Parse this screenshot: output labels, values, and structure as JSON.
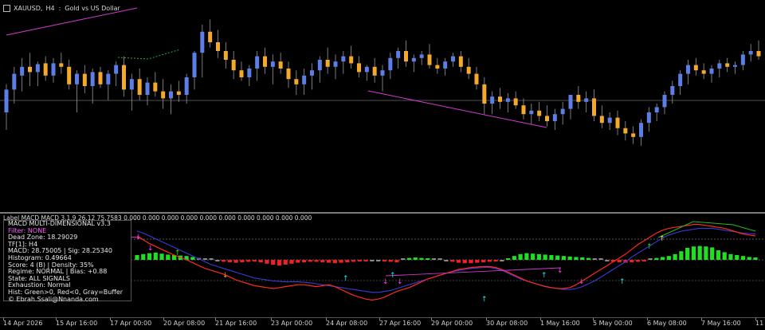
{
  "symbol": {
    "ticker": "XAUUSD",
    "timeframe": "H4",
    "description": "Gold vs US Dollar"
  },
  "indicator_label": "Label MACD  MACD 3.1.9 26.12 75.7583 0.000 0.000 0.000 0.000 0.000 0.000 0.000 0.000 0.000 0.000",
  "panel": {
    "lines": [
      "MACD MULTI-DIMENSIONAL v3.3",
      "Filter: NONE",
      "Dead Zone: 18.29029",
      "TF[1]: H4",
      "MACD: 28.75005 | Sig: 28.25340",
      "Histogram: 0.49664",
      "Score: 4 (B) | Density: 35%",
      "Regime: NORMAL | Bias: +0.88",
      "State: ALL SIGNALS",
      "Exhaustion: Normal",
      "Hist: Green>0, Red<0, Gray=Buffer",
      "© Ebrah.Ssali@Nnanda.com"
    ]
  },
  "time_axis": [
    "14 Apr 2026",
    "15 Apr 16:00",
    "17 Apr 00:00",
    "20 Apr 08:00",
    "21 Apr 16:00",
    "23 Apr 00:00",
    "24 Apr 08:00",
    "27 Apr 16:00",
    "29 Apr 00:00",
    "30 Apr 08:00",
    "1 May 16:00",
    "5 May 00:00",
    "6 May 08:00",
    "7 May 16:00",
    "11"
  ],
  "colors": {
    "bull": "#5b7fe6",
    "bear": "#f4a92a",
    "background": "#000000",
    "hist_green": "#22dd22",
    "hist_red": "#ee2222",
    "hist_gray": "#8a8a8a",
    "macd_line": "#ff2a1a",
    "signal_line": "#3a3ad8",
    "pink": "#ff3cff",
    "cyan": "#22e6e6"
  },
  "candles": [
    {
      "o": 2.1,
      "h": 1.78,
      "l": 2.3,
      "c": 1.84
    },
    {
      "o": 1.84,
      "h": 1.58,
      "l": 2.0,
      "c": 1.66
    },
    {
      "o": 1.68,
      "h": 1.48,
      "l": 1.86,
      "c": 1.58
    },
    {
      "o": 1.58,
      "h": 1.42,
      "l": 1.8,
      "c": 1.64
    },
    {
      "o": 1.64,
      "h": 1.52,
      "l": 1.8,
      "c": 1.55
    },
    {
      "o": 1.54,
      "h": 1.46,
      "l": 1.74,
      "c": 1.68
    },
    {
      "o": 1.68,
      "h": 1.48,
      "l": 1.76,
      "c": 1.54
    },
    {
      "o": 1.54,
      "h": 1.42,
      "l": 1.66,
      "c": 1.58
    },
    {
      "o": 1.58,
      "h": 1.5,
      "l": 1.84,
      "c": 1.78
    },
    {
      "o": 1.78,
      "h": 1.62,
      "l": 2.1,
      "c": 1.66
    },
    {
      "o": 1.66,
      "h": 1.56,
      "l": 1.88,
      "c": 1.8
    },
    {
      "o": 1.8,
      "h": 1.6,
      "l": 2.0,
      "c": 1.64
    },
    {
      "o": 1.64,
      "h": 1.58,
      "l": 1.82,
      "c": 1.78
    },
    {
      "o": 1.78,
      "h": 1.62,
      "l": 1.96,
      "c": 1.66
    },
    {
      "o": 1.66,
      "h": 1.52,
      "l": 1.8,
      "c": 1.56
    },
    {
      "o": 1.56,
      "h": 1.46,
      "l": 1.92,
      "c": 1.84
    },
    {
      "o": 1.84,
      "h": 1.66,
      "l": 2.08,
      "c": 1.72
    },
    {
      "o": 1.72,
      "h": 1.6,
      "l": 1.96,
      "c": 1.9
    },
    {
      "o": 1.9,
      "h": 1.7,
      "l": 2.02,
      "c": 1.76
    },
    {
      "o": 1.76,
      "h": 1.64,
      "l": 1.92,
      "c": 1.86
    },
    {
      "o": 1.86,
      "h": 1.72,
      "l": 2.06,
      "c": 1.94
    },
    {
      "o": 1.94,
      "h": 1.78,
      "l": 2.12,
      "c": 1.86
    },
    {
      "o": 1.86,
      "h": 1.74,
      "l": 1.98,
      "c": 1.9
    },
    {
      "o": 1.9,
      "h": 1.66,
      "l": 2.0,
      "c": 1.7
    },
    {
      "o": 1.7,
      "h": 1.4,
      "l": 1.84,
      "c": 1.42
    },
    {
      "o": 1.42,
      "h": 1.1,
      "l": 1.7,
      "c": 1.18
    },
    {
      "o": 1.18,
      "h": 1.04,
      "l": 1.36,
      "c": 1.3
    },
    {
      "o": 1.3,
      "h": 1.16,
      "l": 1.48,
      "c": 1.4
    },
    {
      "o": 1.4,
      "h": 1.3,
      "l": 1.6,
      "c": 1.5
    },
    {
      "o": 1.5,
      "h": 1.4,
      "l": 1.72,
      "c": 1.62
    },
    {
      "o": 1.62,
      "h": 1.52,
      "l": 1.74,
      "c": 1.7
    },
    {
      "o": 1.7,
      "h": 1.56,
      "l": 1.8,
      "c": 1.6
    },
    {
      "o": 1.6,
      "h": 1.4,
      "l": 1.74,
      "c": 1.46
    },
    {
      "o": 1.46,
      "h": 1.36,
      "l": 1.66,
      "c": 1.58
    },
    {
      "o": 1.58,
      "h": 1.44,
      "l": 1.78,
      "c": 1.52
    },
    {
      "o": 1.52,
      "h": 1.42,
      "l": 1.66,
      "c": 1.6
    },
    {
      "o": 1.6,
      "h": 1.52,
      "l": 1.82,
      "c": 1.72
    },
    {
      "o": 1.72,
      "h": 1.62,
      "l": 1.9,
      "c": 1.78
    },
    {
      "o": 1.78,
      "h": 1.6,
      "l": 1.9,
      "c": 1.68
    },
    {
      "o": 1.68,
      "h": 1.54,
      "l": 1.84,
      "c": 1.62
    },
    {
      "o": 1.62,
      "h": 1.46,
      "l": 1.76,
      "c": 1.5
    },
    {
      "o": 1.5,
      "h": 1.36,
      "l": 1.66,
      "c": 1.58
    },
    {
      "o": 1.58,
      "h": 1.44,
      "l": 1.72,
      "c": 1.52
    },
    {
      "o": 1.52,
      "h": 1.4,
      "l": 1.66,
      "c": 1.46
    },
    {
      "o": 1.46,
      "h": 1.34,
      "l": 1.6,
      "c": 1.54
    },
    {
      "o": 1.54,
      "h": 1.46,
      "l": 1.7,
      "c": 1.64
    },
    {
      "o": 1.64,
      "h": 1.56,
      "l": 1.74,
      "c": 1.58
    },
    {
      "o": 1.58,
      "h": 1.48,
      "l": 1.76,
      "c": 1.68
    },
    {
      "o": 1.68,
      "h": 1.56,
      "l": 1.86,
      "c": 1.62
    },
    {
      "o": 1.62,
      "h": 1.42,
      "l": 1.72,
      "c": 1.48
    },
    {
      "o": 1.48,
      "h": 1.36,
      "l": 1.6,
      "c": 1.4
    },
    {
      "o": 1.4,
      "h": 1.28,
      "l": 1.58,
      "c": 1.52
    },
    {
      "o": 1.52,
      "h": 1.44,
      "l": 1.64,
      "c": 1.48
    },
    {
      "o": 1.48,
      "h": 1.4,
      "l": 1.56,
      "c": 1.44
    },
    {
      "o": 1.44,
      "h": 1.32,
      "l": 1.6,
      "c": 1.56
    },
    {
      "o": 1.56,
      "h": 1.48,
      "l": 1.66,
      "c": 1.6
    },
    {
      "o": 1.6,
      "h": 1.48,
      "l": 1.68,
      "c": 1.52
    },
    {
      "o": 1.52,
      "h": 1.42,
      "l": 1.58,
      "c": 1.46
    },
    {
      "o": 1.46,
      "h": 1.4,
      "l": 1.64,
      "c": 1.58
    },
    {
      "o": 1.58,
      "h": 1.48,
      "l": 1.72,
      "c": 1.66
    },
    {
      "o": 1.66,
      "h": 1.58,
      "l": 1.84,
      "c": 1.78
    },
    {
      "o": 1.78,
      "h": 1.7,
      "l": 2.12,
      "c": 2.0
    },
    {
      "o": 2.0,
      "h": 1.86,
      "l": 2.12,
      "c": 1.92
    },
    {
      "o": 1.92,
      "h": 1.82,
      "l": 2.06,
      "c": 1.98
    },
    {
      "o": 1.98,
      "h": 1.88,
      "l": 2.1,
      "c": 1.94
    },
    {
      "o": 1.94,
      "h": 1.86,
      "l": 2.06,
      "c": 2.02
    },
    {
      "o": 2.02,
      "h": 1.94,
      "l": 2.18,
      "c": 2.12
    },
    {
      "o": 2.12,
      "h": 2.0,
      "l": 2.24,
      "c": 2.08
    },
    {
      "o": 2.08,
      "h": 1.98,
      "l": 2.2,
      "c": 2.14
    },
    {
      "o": 2.14,
      "h": 2.02,
      "l": 2.26,
      "c": 2.2
    },
    {
      "o": 2.2,
      "h": 2.06,
      "l": 2.3,
      "c": 2.12
    },
    {
      "o": 2.12,
      "h": 1.98,
      "l": 2.24,
      "c": 2.06
    },
    {
      "o": 2.06,
      "h": 1.94,
      "l": 2.18,
      "c": 1.9
    },
    {
      "o": 1.9,
      "h": 1.8,
      "l": 2.06,
      "c": 1.98
    },
    {
      "o": 1.98,
      "h": 1.86,
      "l": 2.1,
      "c": 1.94
    },
    {
      "o": 1.94,
      "h": 1.84,
      "l": 2.2,
      "c": 2.14
    },
    {
      "o": 2.14,
      "h": 2.02,
      "l": 2.28,
      "c": 2.22
    },
    {
      "o": 2.22,
      "h": 2.1,
      "l": 2.3,
      "c": 2.16
    },
    {
      "o": 2.16,
      "h": 2.08,
      "l": 2.36,
      "c": 2.28
    },
    {
      "o": 2.28,
      "h": 2.2,
      "l": 2.42,
      "c": 2.34
    },
    {
      "o": 2.34,
      "h": 2.26,
      "l": 2.46,
      "c": 2.38
    },
    {
      "o": 2.38,
      "h": 2.18,
      "l": 2.48,
      "c": 2.22
    },
    {
      "o": 2.22,
      "h": 2.04,
      "l": 2.32,
      "c": 2.1
    },
    {
      "o": 2.1,
      "h": 2.0,
      "l": 2.2,
      "c": 2.04
    },
    {
      "o": 2.04,
      "h": 1.86,
      "l": 2.12,
      "c": 1.9
    },
    {
      "o": 1.9,
      "h": 1.74,
      "l": 2.0,
      "c": 1.8
    },
    {
      "o": 1.8,
      "h": 1.62,
      "l": 1.9,
      "c": 1.66
    },
    {
      "o": 1.66,
      "h": 1.5,
      "l": 1.78,
      "c": 1.56
    },
    {
      "o": 1.56,
      "h": 1.48,
      "l": 1.68,
      "c": 1.62
    },
    {
      "o": 1.62,
      "h": 1.54,
      "l": 1.72,
      "c": 1.66
    },
    {
      "o": 1.66,
      "h": 1.56,
      "l": 1.76,
      "c": 1.6
    },
    {
      "o": 1.6,
      "h": 1.5,
      "l": 1.7,
      "c": 1.54
    },
    {
      "o": 1.54,
      "h": 1.48,
      "l": 1.64,
      "c": 1.58
    },
    {
      "o": 1.58,
      "h": 1.52,
      "l": 1.66,
      "c": 1.56
    },
    {
      "o": 1.56,
      "h": 1.4,
      "l": 1.62,
      "c": 1.44
    },
    {
      "o": 1.44,
      "h": 1.32,
      "l": 1.52,
      "c": 1.4
    },
    {
      "o": 1.4,
      "h": 1.28,
      "l": 1.5,
      "c": 1.46
    }
  ],
  "histogram": [
    0.1,
    0.12,
    0.14,
    0.15,
    0.13,
    0.11,
    0.1,
    0.09,
    0.08,
    0.06,
    0.04,
    0.02,
    0.0,
    -0.02,
    -0.04,
    -0.05,
    -0.06,
    -0.05,
    -0.04,
    -0.03,
    -0.05,
    -0.08,
    -0.1,
    -0.12,
    -0.1,
    -0.08,
    -0.06,
    -0.05,
    -0.04,
    -0.04,
    -0.05,
    -0.06,
    -0.07,
    -0.06,
    -0.05,
    -0.04,
    -0.03,
    -0.03,
    -0.02,
    -0.02,
    -0.03,
    -0.04,
    -0.05,
    0.02,
    0.04,
    0.05,
    0.04,
    0.03,
    0.02,
    0.01,
    -0.02,
    -0.04,
    -0.06,
    -0.07,
    -0.07,
    -0.06,
    -0.05,
    -0.04,
    -0.03,
    -0.02,
    0.03,
    0.08,
    0.12,
    0.14,
    0.13,
    0.12,
    0.11,
    0.1,
    0.09,
    0.08,
    0.07,
    0.06,
    0.05,
    0.04,
    0.02,
    0.01,
    -0.02,
    -0.04,
    -0.05,
    -0.06,
    -0.05,
    -0.04,
    -0.03,
    0.02,
    0.04,
    0.06,
    0.08,
    0.12,
    0.18,
    0.25,
    0.28,
    0.29,
    0.28,
    0.26,
    0.2,
    0.16,
    0.12,
    0.1,
    0.08,
    0.06,
    0.05
  ],
  "macd": [
    0.5,
    0.42,
    0.34,
    0.28,
    0.22,
    0.16,
    0.1,
    0.05,
    0.0,
    -0.06,
    -0.12,
    -0.18,
    -0.22,
    -0.26,
    -0.3,
    -0.36,
    -0.42,
    -0.46,
    -0.5,
    -0.54,
    -0.56,
    -0.58,
    -0.6,
    -0.58,
    -0.56,
    -0.54,
    -0.52,
    -0.52,
    -0.54,
    -0.56,
    -0.54,
    -0.52,
    -0.56,
    -0.62,
    -0.68,
    -0.74,
    -0.78,
    -0.82,
    -0.84,
    -0.82,
    -0.78,
    -0.72,
    -0.66,
    -0.62,
    -0.58,
    -0.52,
    -0.46,
    -0.4,
    -0.36,
    -0.32,
    -0.28,
    -0.24,
    -0.2,
    -0.18,
    -0.16,
    -0.15,
    -0.14,
    -0.14,
    -0.16,
    -0.2,
    -0.26,
    -0.32,
    -0.38,
    -0.44,
    -0.48,
    -0.52,
    -0.56,
    -0.58,
    -0.6,
    -0.6,
    -0.58,
    -0.52,
    -0.44,
    -0.36,
    -0.28,
    -0.2,
    -0.12,
    -0.04,
    0.04,
    0.12,
    0.22,
    0.32,
    0.4,
    0.48,
    0.56,
    0.62,
    0.66,
    0.68,
    0.7,
    0.72,
    0.74,
    0.74,
    0.72,
    0.7,
    0.68,
    0.66,
    0.62,
    0.58,
    0.54,
    0.52,
    0.5
  ],
  "signal": [
    0.6,
    0.56,
    0.5,
    0.44,
    0.38,
    0.32,
    0.26,
    0.2,
    0.14,
    0.08,
    0.02,
    -0.04,
    -0.1,
    -0.14,
    -0.18,
    -0.22,
    -0.26,
    -0.3,
    -0.34,
    -0.38,
    -0.4,
    -0.42,
    -0.44,
    -0.45,
    -0.46,
    -0.46,
    -0.46,
    -0.47,
    -0.48,
    -0.5,
    -0.52,
    -0.54,
    -0.56,
    -0.58,
    -0.6,
    -0.62,
    -0.64,
    -0.66,
    -0.68,
    -0.68,
    -0.66,
    -0.64,
    -0.6,
    -0.56,
    -0.52,
    -0.48,
    -0.44,
    -0.4,
    -0.36,
    -0.32,
    -0.28,
    -0.25,
    -0.22,
    -0.2,
    -0.18,
    -0.17,
    -0.16,
    -0.16,
    -0.18,
    -0.22,
    -0.28,
    -0.34,
    -0.4,
    -0.44,
    -0.48,
    -0.52,
    -0.55,
    -0.58,
    -0.6,
    -0.62,
    -0.62,
    -0.6,
    -0.56,
    -0.5,
    -0.44,
    -0.36,
    -0.28,
    -0.2,
    -0.12,
    -0.04,
    0.06,
    0.14,
    0.22,
    0.3,
    0.38,
    0.46,
    0.52,
    0.56,
    0.6,
    0.62,
    0.64,
    0.66,
    0.66,
    0.66,
    0.64,
    0.62,
    0.6,
    0.58,
    0.56,
    0.55,
    0.54
  ]
}
